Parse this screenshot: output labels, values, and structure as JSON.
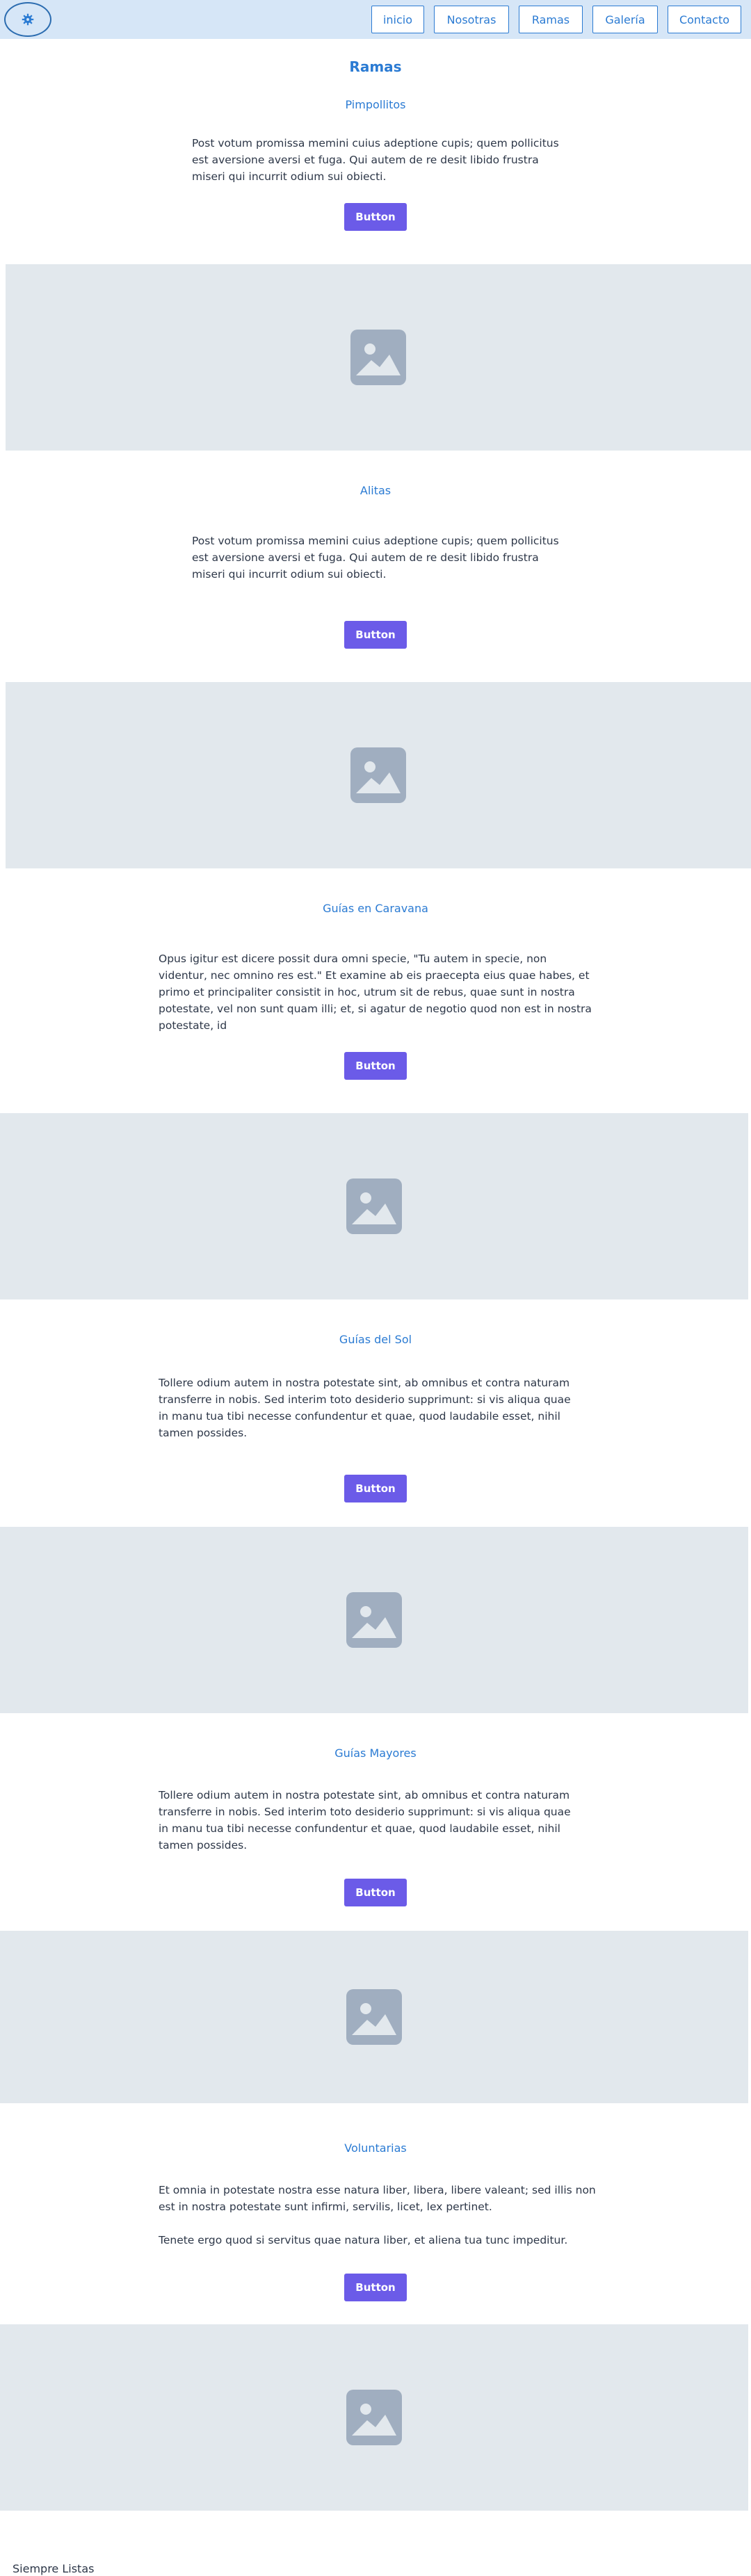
{
  "header": {
    "logo_icon": "gear-logo-icon",
    "nav": [
      {
        "label": "inicio"
      },
      {
        "label": "Nosotras"
      },
      {
        "label": "Ramas"
      },
      {
        "label": "Galería"
      },
      {
        "label": "Contacto"
      }
    ]
  },
  "page_title": "Ramas",
  "sections": [
    {
      "title": "Pimpollitos",
      "paragraphs": [
        "Post votum promissa memini cuius adeptione cupis; quem pollicitus est aversione aversi et fuga. Qui autem de re desit libido frustra miseri qui incurrit odium sui obiecti."
      ],
      "button": "Button"
    },
    {
      "title": "Alitas",
      "paragraphs": [
        "Post votum promissa memini cuius adeptione cupis; quem pollicitus est aversione aversi et fuga. Qui autem de re desit libido frustra miseri qui incurrit odium sui obiecti."
      ],
      "button": "Button"
    },
    {
      "title": "Guías en Caravana",
      "paragraphs": [
        "Opus igitur est dicere possit dura omni specie, \"Tu autem in specie, non videntur, nec omnino res est.\" Et examine ab eis praecepta eius quae habes, et primo et principaliter consistit in hoc, utrum sit de rebus, quae sunt in nostra potestate, vel non sunt quam illi; et, si agatur de negotio quod non est in nostra potestate, id"
      ],
      "button": "Button"
    },
    {
      "title": "Guías del Sol",
      "paragraphs": [
        "Tollere odium autem in nostra potestate sint, ab omnibus et contra naturam transferre in nobis. Sed interim toto desiderio supprimunt: si vis aliqua quae in manu tua tibi necesse confundentur et quae, quod laudabile esset, nihil tamen possides."
      ],
      "button": "Button"
    },
    {
      "title": "Guías Mayores",
      "paragraphs": [
        "Tollere odium autem in nostra potestate sint, ab omnibus et contra naturam transferre in nobis. Sed interim toto desiderio supprimunt: si vis aliqua quae in manu tua tibi necesse confundentur et quae, quod laudabile esset, nihil tamen possides."
      ],
      "button": "Button"
    },
    {
      "title": "Voluntarias",
      "paragraphs": [
        "Et omnia in potestate nostra esse natura liber, libera, libere valeant; sed illis non est in nostra potestate sunt infirmi, servilis, licet, lex pertinet.",
        "Tenete ergo quod si servitus quae natura liber, et aliena tua tunc impeditur."
      ],
      "button": "Button"
    }
  ],
  "image_icon": "image-placeholder-icon",
  "footer": {
    "text": "Siempre Listas"
  }
}
